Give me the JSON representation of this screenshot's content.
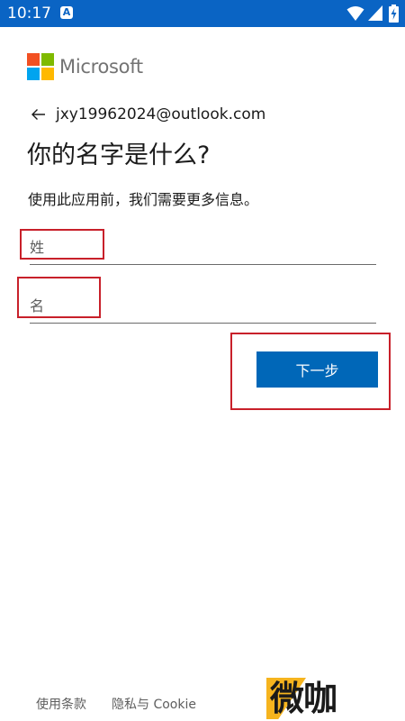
{
  "status_bar": {
    "time": "10:17",
    "notification_icon": "A",
    "background_color": "#0a64c4"
  },
  "brand": {
    "name": "Microsoft",
    "logo_colors": [
      "#f25022",
      "#7fba00",
      "#00a4ef",
      "#ffb900"
    ]
  },
  "account": {
    "back_icon": "arrow-left-icon",
    "email": "jxy19962024@outlook.com"
  },
  "page": {
    "title": "你的名字是什么?",
    "subtitle": "使用此应用前，我们需要更多信息。"
  },
  "form": {
    "last_name": {
      "placeholder": "姓",
      "value": ""
    },
    "first_name": {
      "placeholder": "名",
      "value": ""
    },
    "next_label": "下一步",
    "button_color": "#0067b8"
  },
  "footer": {
    "terms_label": "使用条款",
    "privacy_label": "隐私与 Cookie"
  },
  "watermark": {
    "text": "微咖"
  },
  "annotation_color": "#c8202a"
}
